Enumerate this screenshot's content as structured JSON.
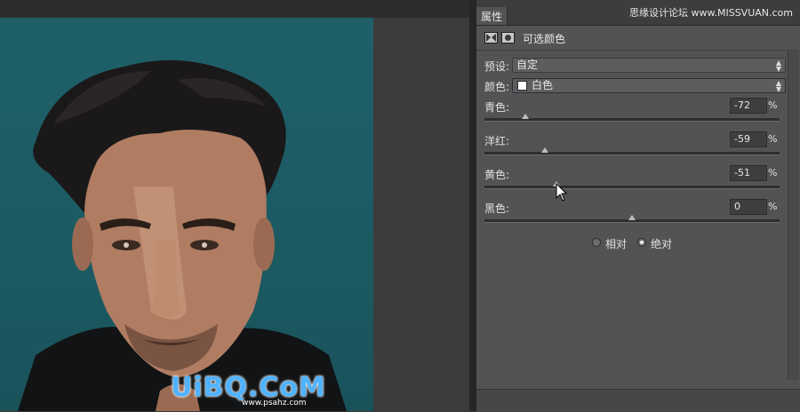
{
  "panel": {
    "tab_label": "属性",
    "title": "可选颜色",
    "preset": {
      "label": "预设:",
      "value": "自定"
    },
    "color": {
      "label": "颜色:",
      "value": "白色",
      "swatch": "#ffffff"
    },
    "sliders": [
      {
        "label": "青色:",
        "value": "-72",
        "unit": "%",
        "level": -72
      },
      {
        "label": "洋红:",
        "value": "-59",
        "unit": "%",
        "level": -59
      },
      {
        "label": "黄色:",
        "value": "-51",
        "unit": "%",
        "level": -51
      },
      {
        "label": "黑色:",
        "value": "0",
        "unit": "%",
        "level": 0
      }
    ],
    "method": {
      "relative_label": "相对",
      "absolute_label": "绝对",
      "selected": "absolute"
    }
  },
  "watermark": {
    "top_text": "思缘设计论坛 www.MISSVUAN.com",
    "brand": "UiBQ.CoM",
    "url": "www.psahz.com"
  },
  "colors": {
    "canvas_bg": "#1f6068",
    "panel_bg": "#535353",
    "brand_blue": "#4fb3ff"
  },
  "icons": {
    "adjustment_layer": "adjustment-layer-icon",
    "layer_mask": "layer-mask-icon",
    "cursor": "arrow-cursor-icon"
  }
}
